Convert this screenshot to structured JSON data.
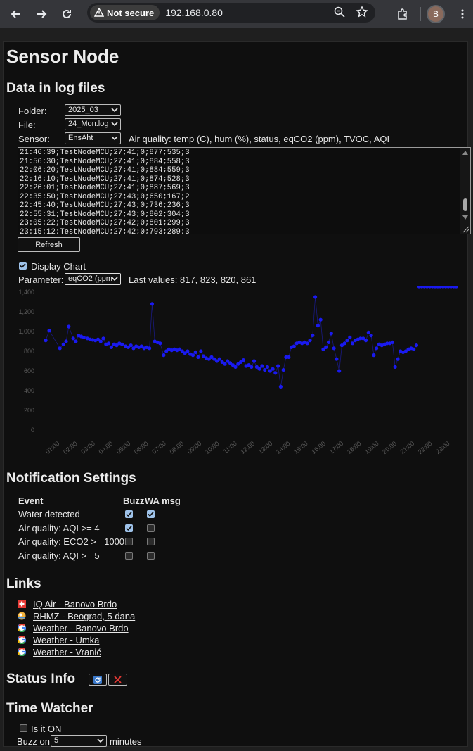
{
  "browser": {
    "security_label": "Not secure",
    "url": "192.168.0.80",
    "profile_initial": "B"
  },
  "page": {
    "title": "Sensor Node",
    "log_section": {
      "heading": "Data in log files",
      "folder_label": "Folder:",
      "folder_value": "2025_03",
      "file_label": "File:",
      "file_value": "24_Mon.log",
      "sensor_label": "Sensor:",
      "sensor_value": "EnsAht",
      "sensor_description": "Air quality: temp (C), hum (%), status, eqCO2 (ppm), TVOC, AQI",
      "log_lines": [
        "21:46:39;TestNodeMCU;27;41;0;877;535;3",
        "21:56:30;TestNodeMCU;27;41;0;884;558;3",
        "22:06:20;TestNodeMCU;27;41;0;884;559;3",
        "22:16:10;TestNodeMCU;27;41;0;874;528;3",
        "22:26:01;TestNodeMCU;27;41;0;887;569;3",
        "22:35:50;TestNodeMCU;27;43;0;650;167;2",
        "22:45:40;TestNodeMCU;27;43;0;736;236;3",
        "22:55:31;TestNodeMCU;27;43;0;802;304;3",
        "23:05:22;TestNodeMCU;27;42;0;801;299;3",
        "23:15:12;TestNodeMCU;27;42;0;793;289;3"
      ],
      "refresh_label": "Refresh",
      "display_chart_label": "Display Chart",
      "display_chart_checked": true,
      "parameter_label": "Parameter:",
      "parameter_value": "eqCO2 (ppm",
      "last_values": "Last values: 817, 823, 820, 861"
    },
    "notifications": {
      "heading": "Notification Settings",
      "col_event": "Event",
      "col_buzz": "Buzz",
      "col_wa": "WA msg",
      "rows": [
        {
          "event": "Water detected",
          "buzz": true,
          "wa": true
        },
        {
          "event": "Air quality: AQI >= 4",
          "buzz": true,
          "wa": false
        },
        {
          "event": "Air quality: ECO2 >= 1000",
          "buzz": false,
          "wa": false
        },
        {
          "event": "Air quality: AQI >= 5",
          "buzz": false,
          "wa": false
        }
      ]
    },
    "links": {
      "heading": "Links",
      "items": [
        {
          "label": "IQ Air - Banovo Brdo",
          "icon": "swiss-flag-icon"
        },
        {
          "label": "RHMZ - Beograd, 5 dana",
          "icon": "rhmz-icon"
        },
        {
          "label": "Weather - Banovo Brdo",
          "icon": "google-icon"
        },
        {
          "label": "Weather - Umka",
          "icon": "google-icon"
        },
        {
          "label": "Weather - Vranić",
          "icon": "google-icon"
        }
      ]
    },
    "status_info": {
      "heading": "Status Info",
      "refresh_icon": "refresh-icon",
      "clear_icon": "close-icon"
    },
    "time_watcher": {
      "heading": "Time Watcher",
      "is_on_label": "Is it ON",
      "is_on_checked": false,
      "buzz_on_label": "Buzz on",
      "buzz_value": "5",
      "minutes_label": "minutes"
    }
  },
  "colors": {
    "point": "#1a1af0",
    "line": "#1a1a80",
    "grid": "#2a2a2a",
    "tick": "#5a5a5a"
  },
  "chart_data": {
    "type": "scatter",
    "ylim": [
      0,
      1400
    ],
    "yticks": [
      "0",
      "200",
      "400",
      "600",
      "800",
      "1,000",
      "1,200",
      "1,400"
    ],
    "xticks": [
      "01:00",
      "02:00",
      "03:00",
      "04:00",
      "05:00",
      "06:00",
      "07:00",
      "08:00",
      "09:00",
      "10:00",
      "11:00",
      "12:00",
      "13:00",
      "14:00",
      "15:00",
      "16:00",
      "17:00",
      "18:00",
      "19:00",
      "20:00",
      "21:00",
      "22:00",
      "23:00"
    ],
    "x_hours": [
      0.2,
      0.4,
      1.0,
      1.2,
      1.35,
      1.5,
      1.75,
      1.9,
      2.05,
      2.2,
      2.35,
      2.55,
      2.7,
      2.85,
      3.0,
      3.15,
      3.3,
      3.45,
      3.6,
      3.75,
      3.9,
      4.05,
      4.2,
      4.35,
      4.5,
      4.7,
      4.85,
      5.0,
      5.15,
      5.3,
      5.45,
      5.6,
      5.75,
      5.9,
      6.05,
      6.2,
      6.35,
      6.5,
      6.65,
      6.85,
      7.0,
      7.15,
      7.3,
      7.45,
      7.6,
      7.75,
      7.9,
      8.05,
      8.2,
      8.35,
      8.5,
      8.65,
      8.8,
      8.95,
      9.1,
      9.25,
      9.4,
      9.55,
      9.7,
      9.85,
      10.0,
      10.15,
      10.3,
      10.45,
      10.6,
      10.75,
      10.9,
      11.05,
      11.2,
      11.35,
      11.5,
      11.65,
      11.8,
      11.95,
      12.1,
      12.25,
      12.4,
      12.55,
      12.7,
      12.85,
      13.0,
      13.15,
      13.3,
      13.45,
      13.6,
      13.75,
      13.9,
      14.05,
      14.2,
      14.35,
      14.5,
      14.65,
      14.8,
      14.95,
      15.1,
      15.25,
      15.4,
      15.55,
      15.7,
      15.85,
      16.0,
      16.15,
      16.3,
      16.45,
      16.6,
      16.75,
      16.9,
      17.05,
      17.2,
      17.35,
      17.5,
      17.65,
      17.8,
      17.95,
      18.1,
      18.25,
      18.4,
      18.55,
      18.7,
      18.85,
      19.0,
      19.15,
      19.3,
      19.45,
      19.6,
      19.75,
      19.9,
      20.05,
      20.2,
      20.35,
      20.5,
      20.65,
      20.8,
      20.95,
      21.1,
      21.25,
      21.4,
      21.55,
      21.7,
      21.85,
      22.0,
      22.15,
      22.3,
      22.45,
      22.6,
      22.75,
      22.9,
      23.05,
      23.2,
      23.35
    ],
    "values": [
      910,
      1010,
      830,
      870,
      900,
      1050,
      930,
      900,
      960,
      950,
      940,
      930,
      920,
      915,
      910,
      920,
      900,
      930,
      870,
      880,
      840,
      870,
      860,
      880,
      870,
      850,
      840,
      860,
      830,
      850,
      840,
      850,
      830,
      840,
      830,
      1280,
      900,
      890,
      880,
      760,
      800,
      820,
      810,
      820,
      810,
      820,
      800,
      780,
      800,
      770,
      760,
      790,
      740,
      800,
      750,
      730,
      720,
      740,
      720,
      700,
      720,
      690,
      670,
      700,
      680,
      660,
      640,
      670,
      690,
      710,
      650,
      660,
      640,
      700,
      640,
      620,
      650,
      610,
      640,
      600,
      620,
      580,
      650,
      440,
      610,
      740,
      740,
      840,
      850,
      880,
      890,
      880,
      890,
      880,
      910,
      960,
      1350,
      1060,
      1120,
      820,
      840,
      890,
      980,
      830,
      720,
      600,
      860,
      880,
      910,
      940,
      880,
      910,
      920,
      930,
      930,
      910,
      990,
      960,
      760,
      830,
      870,
      860,
      870,
      880,
      880,
      890,
      640,
      720,
      800,
      790,
      800,
      820,
      830,
      820,
      860
    ]
  }
}
